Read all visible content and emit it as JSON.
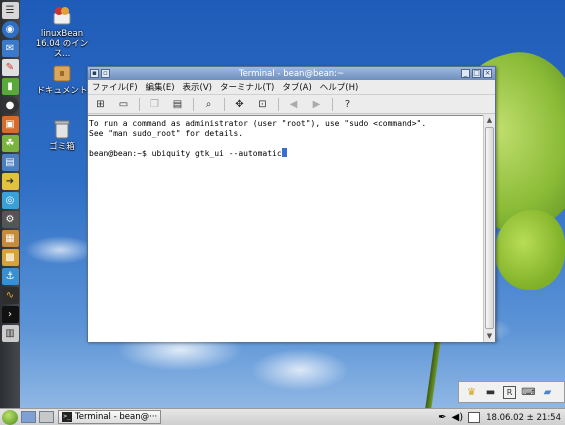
{
  "desktop_icons": [
    {
      "name": "linuxbean-installer",
      "label_line1": "linuxBean",
      "label_line2": "16.04 のインス..."
    },
    {
      "name": "documents",
      "label_line1": "ドキュメント",
      "label_line2": ""
    },
    {
      "name": "trash",
      "label_line1": "ゴミ箱",
      "label_line2": ""
    }
  ],
  "window": {
    "title": "Terminal - bean@bean:~",
    "menu": [
      "ファイル(F)",
      "編集(E)",
      "表示(V)",
      "ターミナル(T)",
      "タブ(A)",
      "ヘルプ(H)"
    ]
  },
  "terminal": {
    "line1": "To run a command as administrator (user \"root\"), use \"sudo <command>\".",
    "line2": "See \"man sudo_root\" for details.",
    "prompt": "bean@bean:~$ ",
    "command": "ubiquity gtk_ui --automatic"
  },
  "taskbar": {
    "task_label": "Terminal - bean@···",
    "clock": "18.06.02 ± 21:54"
  },
  "tray_icons": [
    "crown-icon",
    "minimize-icon",
    "registered-icon",
    "keyboard-icon",
    "eraser-icon"
  ],
  "colors": {
    "title_bar": "#7f9ccb",
    "cursor": "#3a6ed0",
    "sky": "#2a63b8",
    "leaf": "#8fbf2f"
  }
}
